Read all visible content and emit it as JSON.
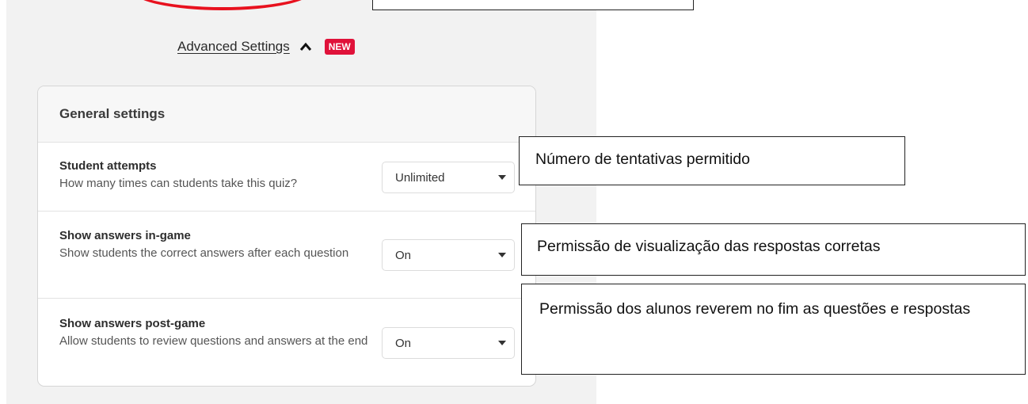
{
  "advanced_settings": {
    "label": "Advanced Settings",
    "badge": "NEW",
    "icon": "chevron-up-icon"
  },
  "general_settings": {
    "title": "General settings",
    "rows": [
      {
        "title": "Student attempts",
        "description": "How many times can students take this quiz?",
        "value": "Unlimited"
      },
      {
        "title": "Show answers in-game",
        "description": "Show students the correct answers after each question",
        "value": "On"
      },
      {
        "title": "Show answers post-game",
        "description": "Allow students to review questions and answers at the end",
        "value": "On"
      }
    ]
  },
  "annotations": [
    "Número de tentativas permitido",
    "Permissão de visualização das respostas corretas",
    "Permissão dos alunos reverem no fim as questões e respostas"
  ],
  "colors": {
    "badge": "#e0123a",
    "oval": "#e8111e",
    "panel": "#f2f2f2"
  }
}
